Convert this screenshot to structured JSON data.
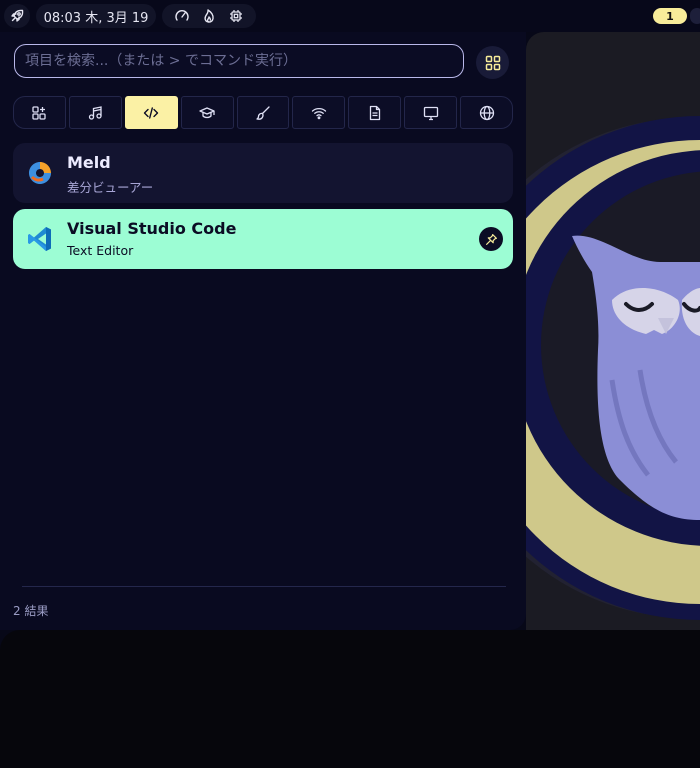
{
  "topbar": {
    "launcher_icon": "rocket-icon",
    "clock": "08:03 木, 3月 19",
    "status_icons": [
      "gauge-icon",
      "flame-icon",
      "cpu-icon"
    ],
    "workspace_badge": "1"
  },
  "search": {
    "placeholder": "項目を検索...（または > でコマンド実行）",
    "value": ""
  },
  "grid_button": {
    "icon": "grid-icon"
  },
  "categories": [
    {
      "icon": "apps-icon",
      "active": false
    },
    {
      "icon": "music-icon",
      "active": false
    },
    {
      "icon": "code-icon",
      "active": true
    },
    {
      "icon": "graduation-cap-icon",
      "active": false
    },
    {
      "icon": "brush-icon",
      "active": false
    },
    {
      "icon": "wifi-icon",
      "active": false
    },
    {
      "icon": "document-icon",
      "active": false
    },
    {
      "icon": "monitor-icon",
      "active": false
    },
    {
      "icon": "globe-icon",
      "active": false
    }
  ],
  "results": [
    {
      "title": "Meld",
      "subtitle": "差分ビューアー",
      "icon": "meld-icon",
      "selected": false
    },
    {
      "title": "Visual Studio Code",
      "subtitle": "Text Editor",
      "icon": "vscode-icon",
      "selected": true,
      "action_icon": "pin-icon"
    }
  ],
  "result_count": "2 結果",
  "colors": {
    "panel_bg": "#090a20",
    "accent_yellow": "#fbf1a5",
    "selected_green": "#9cfdd4",
    "search_border": "#b9b8ea"
  }
}
